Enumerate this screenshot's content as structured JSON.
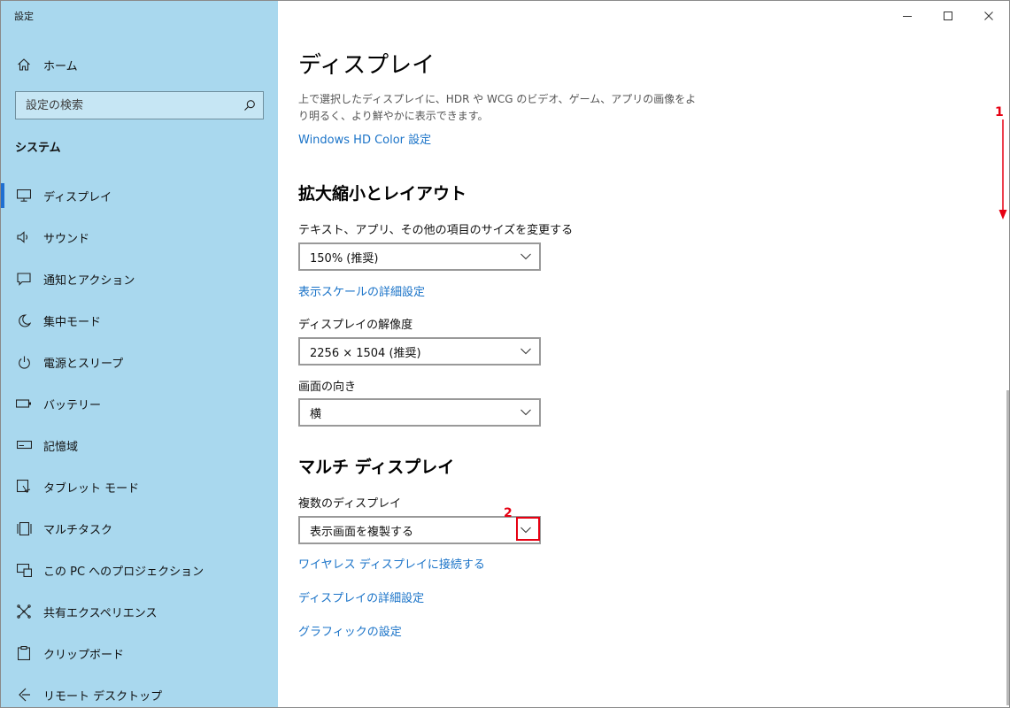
{
  "window": {
    "app_title": "設定"
  },
  "sidebar": {
    "home_label": "ホーム",
    "search_placeholder": "設定の検索",
    "section_title": "システム",
    "items": [
      {
        "label": "ディスプレイ",
        "icon": "monitor-icon",
        "active": true
      },
      {
        "label": "サウンド",
        "icon": "speaker-icon"
      },
      {
        "label": "通知とアクション",
        "icon": "notification-icon"
      },
      {
        "label": "集中モード",
        "icon": "moon-icon"
      },
      {
        "label": "電源とスリープ",
        "icon": "power-icon"
      },
      {
        "label": "バッテリー",
        "icon": "battery-icon"
      },
      {
        "label": "記憶域",
        "icon": "storage-icon"
      },
      {
        "label": "タブレット モード",
        "icon": "tablet-mode-icon"
      },
      {
        "label": "マルチタスク",
        "icon": "multitask-icon"
      },
      {
        "label": "この PC へのプロジェクション",
        "icon": "projection-icon"
      },
      {
        "label": "共有エクスペリエンス",
        "icon": "shared-experience-icon"
      },
      {
        "label": "クリップボード",
        "icon": "clipboard-icon"
      },
      {
        "label": "リモート デスクトップ",
        "icon": "remote-desktop-icon"
      }
    ]
  },
  "main": {
    "title": "ディスプレイ",
    "hdr_description": "上で選択したディスプレイに、HDR や WCG のビデオ、ゲーム、アプリの画像をより明るく、より鮮やかに表示できます。",
    "hdr_link": "Windows HD Color 設定",
    "scale_section": "拡大縮小とレイアウト",
    "text_size_label": "テキスト、アプリ、その他の項目のサイズを変更する",
    "text_size_value": "150% (推奨)",
    "advanced_scaling_link": "表示スケールの詳細設定",
    "resolution_label": "ディスプレイの解像度",
    "resolution_value": "2256 × 1504 (推奨)",
    "orientation_label": "画面の向き",
    "orientation_value": "横",
    "multi_section": "マルチ ディスプレイ",
    "multi_label": "複数のディスプレイ",
    "multi_value": "表示画面を複製する",
    "wireless_link": "ワイヤレス ディスプレイに接続する",
    "advanced_display_link": "ディスプレイの詳細設定",
    "graphics_link": "グラフィックの設定"
  },
  "annotations": {
    "step1": "1",
    "step2": "2",
    "color": "#e60012"
  }
}
